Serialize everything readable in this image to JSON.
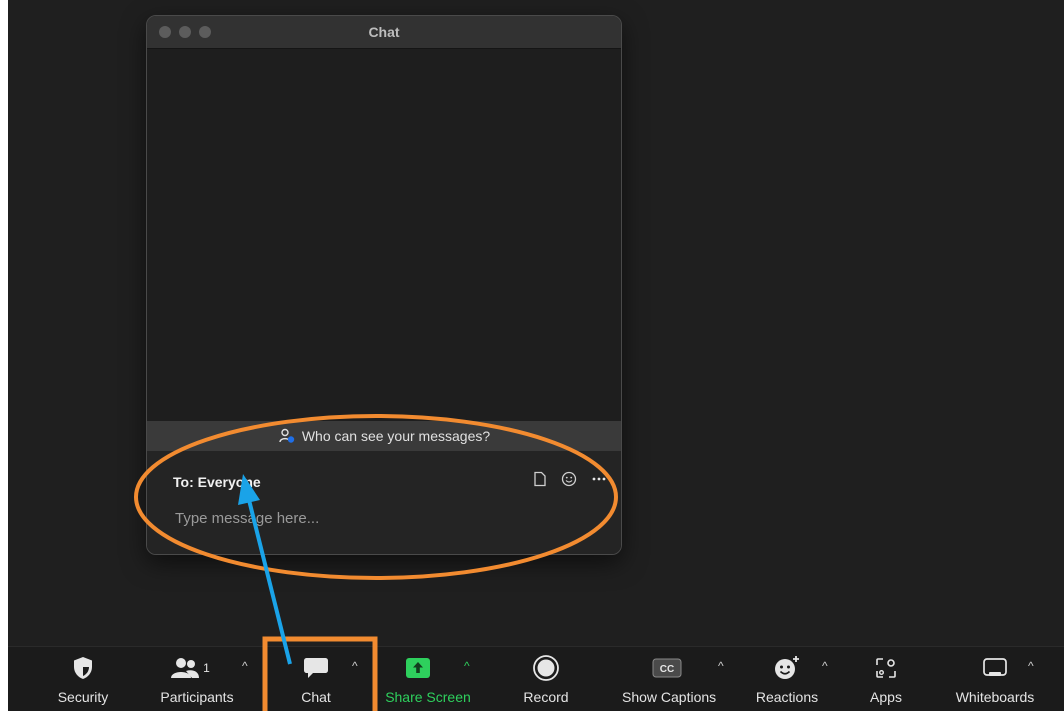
{
  "chat_window": {
    "title": "Chat",
    "privacy_notice": "Who can see your messages?",
    "recipient": "To: Everyone",
    "input_placeholder": "Type message here..."
  },
  "toolbar": {
    "security": "Security",
    "participants": "Participants",
    "participants_count": "1",
    "chat": "Chat",
    "share_screen": "Share Screen",
    "record": "Record",
    "show_captions": "Show Captions",
    "captions_icon_text": "CC",
    "reactions": "Reactions",
    "apps": "Apps",
    "whiteboards": "Whiteboards"
  },
  "annotations": {
    "ellipse_color": "#f28b30",
    "box_color": "#f28b30",
    "arrow_color": "#1aa3e8"
  },
  "colors": {
    "share_green": "#2ed05d",
    "background": "#1f1f1f"
  }
}
